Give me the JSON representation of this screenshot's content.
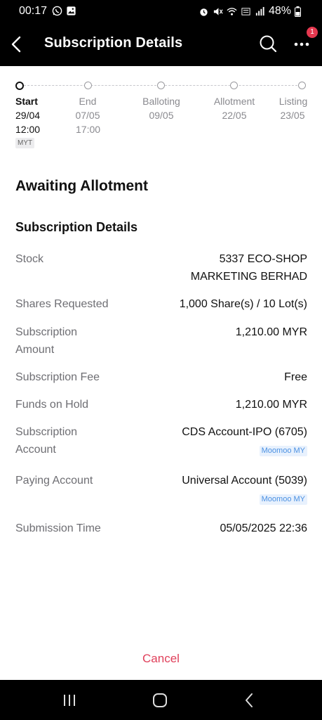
{
  "status_bar": {
    "time": "00:17",
    "battery": "48%"
  },
  "header": {
    "title": "Subscription Details",
    "notification_count": "1"
  },
  "timeline": {
    "steps": [
      {
        "label": "Start",
        "date": "29/04",
        "time": "12:00"
      },
      {
        "label": "End",
        "date": "07/05",
        "time": "17:00"
      },
      {
        "label": "Balloting",
        "date": "09/05"
      },
      {
        "label": "Allotment",
        "date": "22/05"
      },
      {
        "label": "Listing",
        "date": "23/05"
      }
    ],
    "timezone": "MYT"
  },
  "status_title": "Awaiting Allotment",
  "section_title": "Subscription Details",
  "details": {
    "stock": {
      "label": "Stock",
      "value_line1": "5337 ECO-SHOP",
      "value_line2": "MARKETING BERHAD"
    },
    "shares": {
      "label": "Shares Requested",
      "value": "1,000 Share(s) / 10 Lot(s)"
    },
    "amount": {
      "label_line1": "Subscription",
      "label_line2": "Amount",
      "value": "1,210.00 MYR"
    },
    "fee": {
      "label": "Subscription Fee",
      "value": "Free"
    },
    "funds": {
      "label": "Funds on Hold",
      "value": "1,210.00 MYR"
    },
    "sub_account": {
      "label_line1": "Subscription",
      "label_line2": "Account",
      "value": "CDS Account-IPO (6705)",
      "tag": "Moomoo MY"
    },
    "paying": {
      "label": "Paying Account",
      "value": "Universal Account (5039)",
      "tag": "Moomoo MY"
    },
    "submission": {
      "label": "Submission Time",
      "value": "05/05/2025 22:36"
    }
  },
  "actions": {
    "cancel": "Cancel"
  },
  "colors": {
    "accent_cancel": "#e0405b",
    "badge": "#e5384f",
    "tag_text": "#4a90e2",
    "tag_bg": "#e8f1fd"
  }
}
